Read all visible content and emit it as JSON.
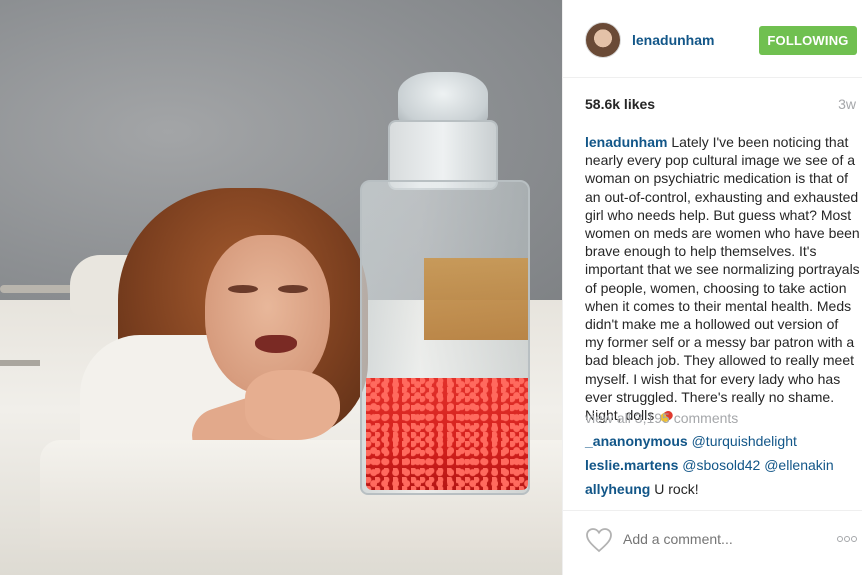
{
  "post": {
    "image_alt": "",
    "author": {
      "username": "lenadunham",
      "follow_label": "FOLLOWING"
    },
    "likes": "58.6k likes",
    "age": "3w",
    "caption": {
      "username": "lenadunham",
      "text": "Lately I've been noticing that nearly every pop cultural image we see of a woman on psychiatric medication is that of an out-of-control, exhausting and exhausted girl who needs help. But guess what? Most women on meds are women who have been brave enough to help themselves. It's important that we see normalizing portrayals of people, women, choosing to take action when it comes to their mental health. Meds didn't make me a hollowed out version of my former self or a messy bar patron with a bad bleach job. They allowed to really meet myself. I wish that for every lady who has ever struggled. There's really no shame. Night, dolls",
      "emoji_icon": "pill-icon"
    },
    "view_all_comments": "view all 3,195 comments",
    "comments": [
      {
        "user": "_ananonymous",
        "text": "@turquishdelight"
      },
      {
        "user": "leslie.martens",
        "text": "@sbosold42 @ellenakin"
      },
      {
        "user": "allyheung",
        "text": "U rock!"
      }
    ],
    "add_comment_placeholder": "Add a comment...",
    "more_icon": "more-options-icon",
    "like_icon": "heart-icon"
  },
  "colors": {
    "username": "#125688",
    "follow_button": "#70c050",
    "muted": "#a5a7aa"
  }
}
